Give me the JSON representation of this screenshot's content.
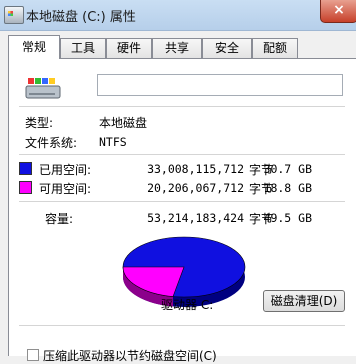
{
  "window": {
    "title": "本地磁盘 (C:) 属性",
    "close_label": "×"
  },
  "tabs": [
    "常规",
    "工具",
    "硬件",
    "共享",
    "安全",
    "配额"
  ],
  "general": {
    "name_value": "",
    "type_label": "类型:",
    "type_value": "本地磁盘",
    "fs_label": "文件系统:",
    "fs_value": "NTFS",
    "used": {
      "label": "已用空间:",
      "bytes": "33,008,115,712",
      "unit": "字节",
      "size": "30.7 GB",
      "color": "#1010e0"
    },
    "free": {
      "label": "可用空间:",
      "bytes": "20,206,067,712",
      "unit": "字节",
      "size": "18.8 GB",
      "color": "#ff00ff"
    },
    "capacity": {
      "label": "容量:",
      "bytes": "53,214,183,424",
      "unit": "字节",
      "size": "49.5 GB"
    },
    "drive_label": "驱动器 C:",
    "cleanup_button": "磁盘清理(D)",
    "compress_label": "压缩此驱动器以节约磁盘空间(C)",
    "compress_checked": false
  }
}
